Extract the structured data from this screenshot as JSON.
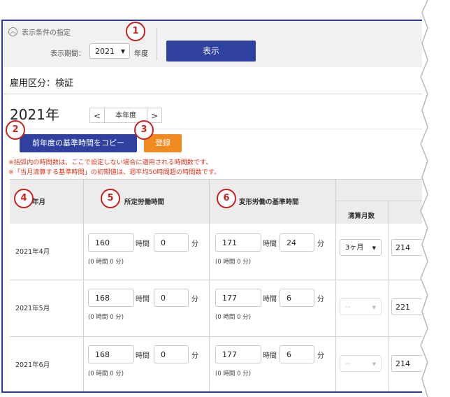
{
  "filter": {
    "toggle_label": "表示条件の指定",
    "period_label": "表示期間：",
    "year_value": "2021",
    "year_unit": "年度",
    "show_button": "表示"
  },
  "employment": "雇用区分：検証",
  "year_title": "2021年",
  "nav": {
    "prev": "<",
    "current": "本年度",
    "next": ">"
  },
  "actions": {
    "copy_button": "前年度の基準時間をコピー",
    "register_button": "登録"
  },
  "notes": [
    "※括弧内の時間数は、ここで設定しない場合に適用される時間数です。",
    "※「当月清算する基準時間」の初期値は、週平均50時間超の時間数です。"
  ],
  "badges": [
    "1",
    "2",
    "3",
    "4",
    "5",
    "6"
  ],
  "table": {
    "headers": {
      "month": "年月",
      "scheduled": "所定労働時間",
      "variable": "変形労働の基準時間",
      "settlement_months": "清算月数"
    },
    "units": {
      "hour": "時間",
      "minute": "分"
    },
    "rows": [
      {
        "month": "2021年4月",
        "sched_h": "160",
        "sched_m": "0",
        "sched_sub": "(0 時間 0 分)",
        "var_h": "171",
        "var_m": "24",
        "var_sub": "(0 時間 0 分)",
        "settle": "3ヶ月",
        "last": "214"
      },
      {
        "month": "2021年5月",
        "sched_h": "168",
        "sched_m": "0",
        "sched_sub": "(0 時間 0 分)",
        "var_h": "177",
        "var_m": "6",
        "var_sub": "(0 時間 0 分)",
        "settle": "--",
        "last": "221"
      },
      {
        "month": "2021年6月",
        "sched_h": "168",
        "sched_m": "0",
        "sched_sub": "(0 時間 0 分)",
        "var_h": "177",
        "var_m": "6",
        "var_sub": "(0 時間 0 分)",
        "settle": "--",
        "last": "214"
      }
    ]
  }
}
